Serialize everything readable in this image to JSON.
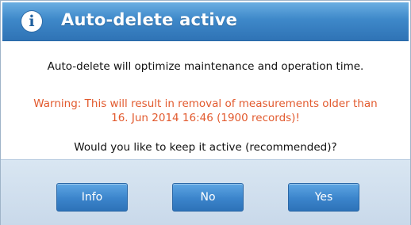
{
  "dialog": {
    "title": "Auto-delete active",
    "icon": "info-icon",
    "message": "Auto-delete will optimize maintenance and operation time.",
    "warning_line1": "Warning: This will result in removal of measurements older than",
    "warning_line2": "16. Jun 2014 16:46 (1900 records)!",
    "question": "Would you like to keep it active (recommended)?",
    "buttons": {
      "info": "Info",
      "no": "No",
      "yes": "Yes"
    }
  },
  "colors": {
    "title_bar": "#3e88c9",
    "warning_text": "#e25a2e",
    "button": "#3b84cb",
    "footer": "#d9e6f2"
  }
}
